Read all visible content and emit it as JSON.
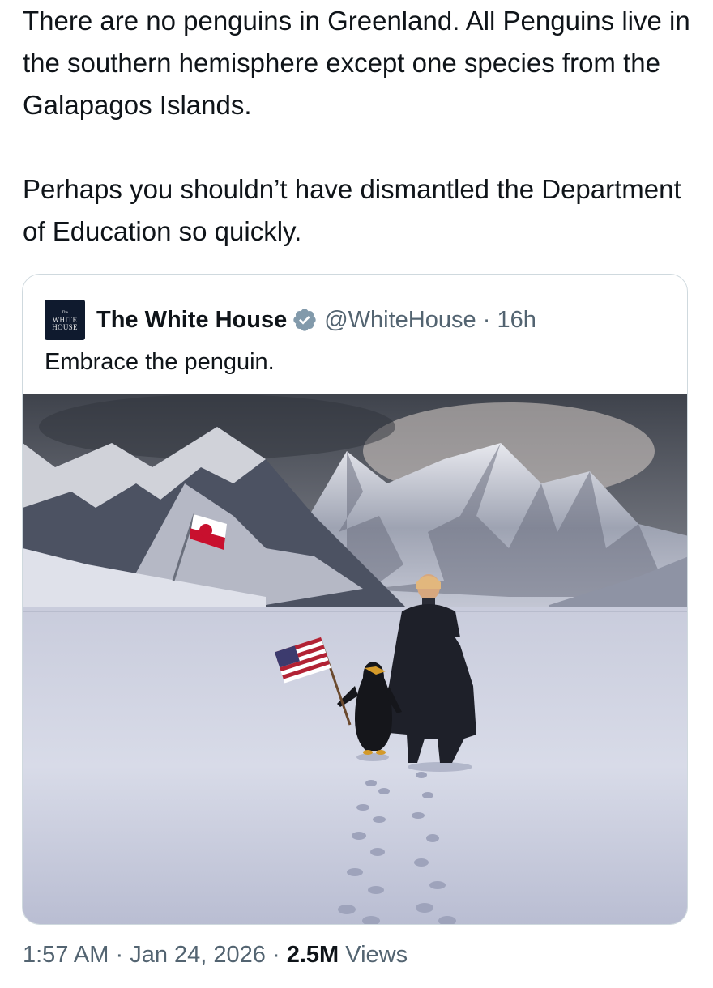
{
  "tweet": {
    "paragraphs": [
      "There are no penguins in Greenland. All Penguins live in the southern hemisphere except one species from the Galapagos Islands.",
      "Perhaps you shouldn’t have dismantled the Department of Education so quickly."
    ],
    "time": "1:57 AM",
    "separator": "·",
    "date": "Jan 24, 2026",
    "views_count": "2.5M",
    "views_label": "Views"
  },
  "quoted_tweet": {
    "avatar_text_top": "The",
    "avatar_text_line1": "WHITE",
    "avatar_text_line2": "HOUSE",
    "name": "The White House",
    "verified": true,
    "verified_icon": "verified-badge-icon",
    "handle": "@WhiteHouse",
    "separator": "·",
    "age": "16h",
    "text": "Embrace the penguin.",
    "image_icon": "snowy-mountains-penguin-photo"
  },
  "colors": {
    "text_primary": "#0f1419",
    "text_secondary": "#536471",
    "border": "#cfd9de",
    "verified_badge": "#829aab",
    "avatar_bg": "#0f1a2e"
  }
}
